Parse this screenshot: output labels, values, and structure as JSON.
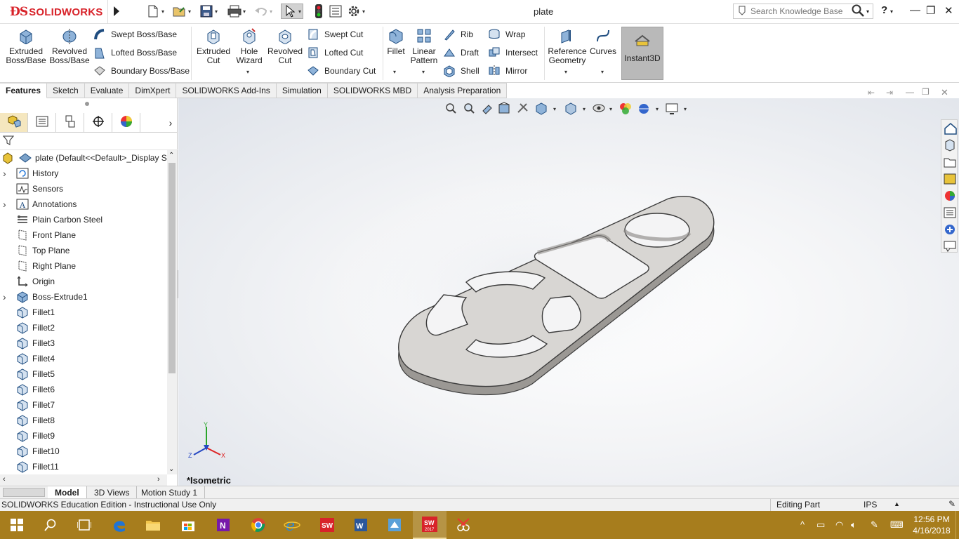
{
  "app": {
    "brand": "SOLIDWORKS",
    "document_title": "plate"
  },
  "titlebar": {
    "search_placeholder": "Search Knowledge Base",
    "help": "?",
    "minimize": "—",
    "restore": "❐",
    "close": "✕"
  },
  "ribbon": {
    "extruded_boss": [
      "Extruded",
      "Boss/Base"
    ],
    "revolved_boss": [
      "Revolved",
      "Boss/Base"
    ],
    "swept_boss": "Swept Boss/Base",
    "lofted_boss": "Lofted Boss/Base",
    "boundary_boss": "Boundary Boss/Base",
    "extruded_cut": [
      "Extruded",
      "Cut"
    ],
    "hole_wizard": [
      "Hole",
      "Wizard"
    ],
    "revolved_cut": [
      "Revolved",
      "Cut"
    ],
    "swept_cut": "Swept Cut",
    "lofted_cut": "Lofted Cut",
    "boundary_cut": "Boundary Cut",
    "fillet": "Fillet",
    "linear_pattern": [
      "Linear",
      "Pattern"
    ],
    "rib": "Rib",
    "draft": "Draft",
    "shell": "Shell",
    "wrap": "Wrap",
    "intersect": "Intersect",
    "mirror": "Mirror",
    "reference_geometry": [
      "Reference",
      "Geometry"
    ],
    "curves": "Curves",
    "instant3d": "Instant3D"
  },
  "command_tabs": [
    "Features",
    "Sketch",
    "Evaluate",
    "DimXpert",
    "SOLIDWORKS Add-Ins",
    "Simulation",
    "SOLIDWORKS MBD",
    "Analysis Preparation"
  ],
  "feature_tree": {
    "root": "plate  (Default<<Default>_Display S",
    "items": [
      {
        "label": "History",
        "expand": true,
        "icon": "history-icon"
      },
      {
        "label": "Sensors",
        "expand": false,
        "icon": "sensors-icon"
      },
      {
        "label": "Annotations",
        "expand": true,
        "icon": "annotations-icon"
      },
      {
        "label": "Plain Carbon Steel",
        "expand": false,
        "icon": "material-icon"
      },
      {
        "label": "Front Plane",
        "expand": false,
        "icon": "plane-icon"
      },
      {
        "label": "Top Plane",
        "expand": false,
        "icon": "plane-icon"
      },
      {
        "label": "Right Plane",
        "expand": false,
        "icon": "plane-icon"
      },
      {
        "label": "Origin",
        "expand": false,
        "icon": "origin-icon"
      },
      {
        "label": "Boss-Extrude1",
        "expand": true,
        "icon": "extrude-icon"
      },
      {
        "label": "Fillet1",
        "expand": false,
        "icon": "fillet-icon"
      },
      {
        "label": "Fillet2",
        "expand": false,
        "icon": "fillet-icon"
      },
      {
        "label": "Fillet3",
        "expand": false,
        "icon": "fillet-icon"
      },
      {
        "label": "Fillet4",
        "expand": false,
        "icon": "fillet-icon"
      },
      {
        "label": "Fillet5",
        "expand": false,
        "icon": "fillet-icon"
      },
      {
        "label": "Fillet6",
        "expand": false,
        "icon": "fillet-icon"
      },
      {
        "label": "Fillet7",
        "expand": false,
        "icon": "fillet-icon"
      },
      {
        "label": "Fillet8",
        "expand": false,
        "icon": "fillet-icon"
      },
      {
        "label": "Fillet9",
        "expand": false,
        "icon": "fillet-icon"
      },
      {
        "label": "Fillet10",
        "expand": false,
        "icon": "fillet-icon"
      },
      {
        "label": "Fillet11",
        "expand": false,
        "icon": "fillet-icon"
      }
    ]
  },
  "viewport": {
    "view_name": "*Isometric",
    "triad": {
      "y": "Y",
      "x": "X",
      "z": "Z"
    }
  },
  "bottom_tabs": [
    "Model",
    "3D Views",
    "Motion Study 1"
  ],
  "statusbar": {
    "edition": "SOLIDWORKS Education Edition - Instructional Use Only",
    "mode": "Editing Part",
    "units": "IPS"
  },
  "taskbar": {
    "time": "12:56 PM",
    "date": "4/16/2018"
  },
  "colors": {
    "brand_red": "#d8232a",
    "taskbar": "#a77d1d",
    "part_face": "#d8d6d3",
    "part_side": "#9b9894"
  }
}
